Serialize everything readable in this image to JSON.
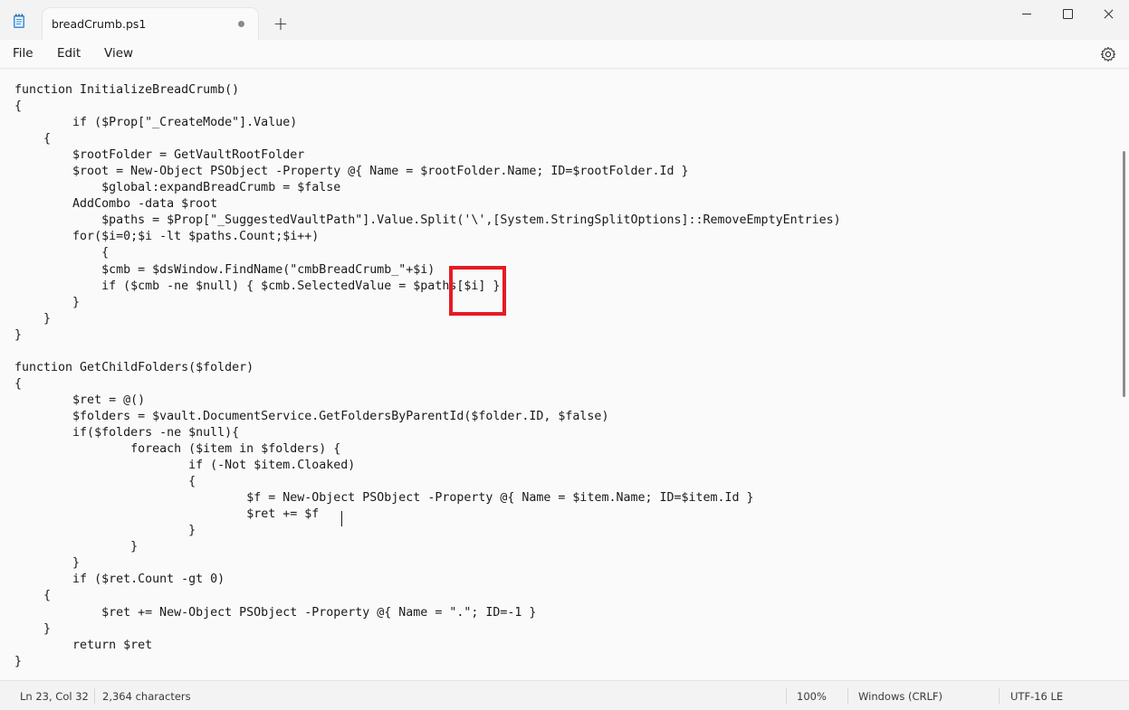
{
  "window": {
    "tab_title": "breadCrumb.ps1",
    "new_tab_label": "+",
    "app_icon": "notepad-icon",
    "controls": [
      "minimize-icon",
      "maximize-icon",
      "close-icon"
    ]
  },
  "menu": {
    "items": [
      "File",
      "Edit",
      "View"
    ],
    "settings_icon": "gear-icon"
  },
  "editor": {
    "lines": [
      "function InitializeBreadCrumb()",
      "{",
      "\tif ($Prop[\"_CreateMode\"].Value)",
      "    {",
      "\t$rootFolder = GetVaultRootFolder",
      "\t$root = New-Object PSObject -Property @{ Name = $rootFolder.Name; ID=$rootFolder.Id }",
      "\t    $global:expandBreadCrumb = $false",
      "\tAddCombo -data $root",
      "\t    $paths = $Prop[\"_SuggestedVaultPath\"].Value.Split('\\',[System.StringSplitOptions]::RemoveEmptyEntries)",
      "\tfor($i=0;$i -lt $paths.Count;$i++)",
      "\t    {",
      "\t    $cmb = $dsWindow.FindName(\"cmbBreadCrumb_\"+$i)",
      "\t    if ($cmb -ne $null) { $cmb.SelectedValue = $paths[$i] }",
      "\t}",
      "    }",
      "}",
      "",
      "function GetChildFolders($folder)",
      "{",
      "\t$ret = @()",
      "\t$folders = $vault.DocumentService.GetFoldersByParentId($folder.ID, $false)",
      "\tif($folders -ne $null){",
      "\t\tforeach ($item in $folders) {",
      "\t\t\tif (-Not $item.Cloaked)",
      "\t\t\t{",
      "\t\t\t\t$f = New-Object PSObject -Property @{ Name = $item.Name; ID=$item.Id }",
      "\t\t\t\t$ret += $f",
      "\t\t\t}",
      "\t\t}",
      "\t}",
      "\tif ($ret.Count -gt 0)",
      "    {",
      "\t    $ret += New-Object PSObject -Property @{ Name = \".\"; ID=-1 }",
      "    }",
      "\treturn $ret",
      "}"
    ],
    "highlight_color": "#e51b23"
  },
  "status": {
    "position": "Ln 23, Col 32",
    "characters": "2,364 characters",
    "zoom": "100%",
    "line_ending": "Windows (CRLF)",
    "encoding": "UTF-16 LE"
  }
}
